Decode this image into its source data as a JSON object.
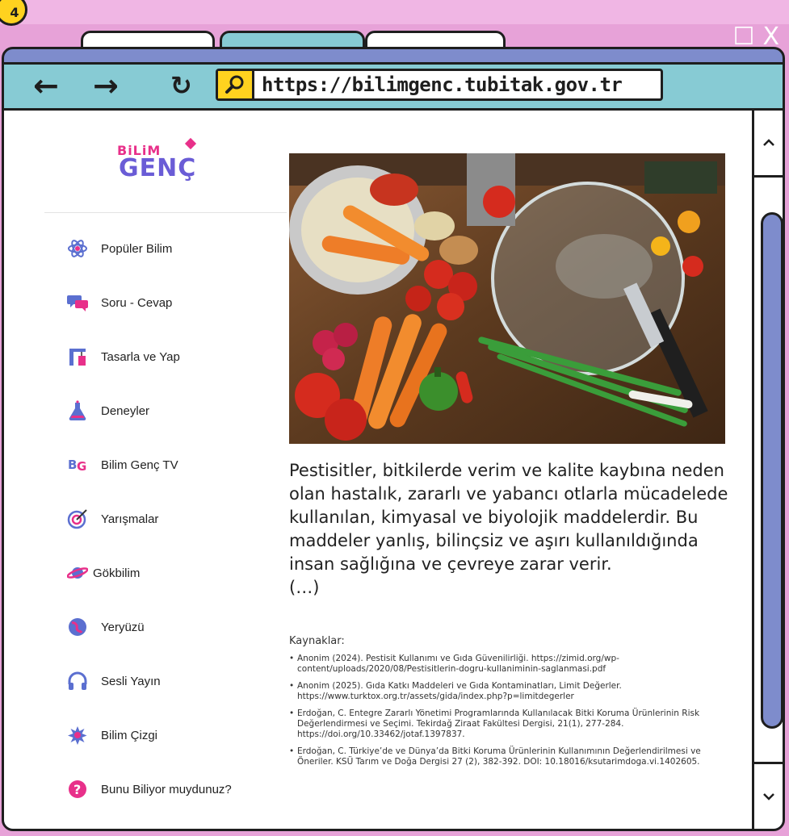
{
  "page_number": "4",
  "window_controls": {
    "minimize": "_",
    "maximize": "☐",
    "close": "X"
  },
  "toolbar": {
    "back": "←",
    "forward": "→",
    "reload": "↻",
    "url": "https://bilimgenc.tubitak.gov.tr"
  },
  "logo": {
    "line1": "BiLiM",
    "line2": "GENÇ"
  },
  "nav": [
    {
      "label": "Popüler Bilim",
      "icon": "atom-icon"
    },
    {
      "label": "Soru - Cevap",
      "icon": "chat-bubbles-icon"
    },
    {
      "label": "Tasarla ve Yap",
      "icon": "crane-icon"
    },
    {
      "label": "Deneyler",
      "icon": "flask-icon"
    },
    {
      "label": "Bilim Genç TV",
      "icon": "bg-tv-icon"
    },
    {
      "label": "Yarışmalar",
      "icon": "target-icon"
    },
    {
      "label": "Gökbilim",
      "icon": "planet-icon"
    },
    {
      "label": "Yeryüzü",
      "icon": "globe-icon"
    },
    {
      "label": "Sesli Yayın",
      "icon": "headphones-icon"
    },
    {
      "label": "Bilim Çizgi",
      "icon": "splash-icon"
    },
    {
      "label": "Bunu Biliyor muydunuz?",
      "icon": "question-icon"
    }
  ],
  "article": {
    "body": "Pestisitler, bitkilerde verim ve kalite kaybına neden olan hastalık, zararlı ve yabancı otlarla mücadelede kullanılan, kimyasal ve biyolojik maddelerdir. Bu maddeler yanlış, bilinçsiz ve aşırı kullanıldığında insan sağlığına ve çevreye zarar verir.",
    "ellipsis": "(…)",
    "refs_title": "Kaynaklar:",
    "refs": [
      "Anonim (2024). Pestisit Kullanımı ve Gıda Güvenilirliği. https://zimid.org/wp-content/uploads/2020/08/Pestisitlerin-dogru-kullaniminin-saglanmasi.pdf",
      "Anonim (2025). Gıda Katkı Maddeleri ve Gıda Kontaminatları, Limit Değerler. https://www.turktox.org.tr/assets/gida/index.php?p=limitdegerler",
      "Erdoğan, C. Entegre Zararlı Yönetimi Programlarında Kullanılacak Bitki Koruma Ürünlerinin Risk Değerlendirmesi ve Seçimi. Tekirdağ Ziraat Fakültesi Dergisi, 21(1), 277-284. https://doi.org/10.33462/jotaf.1397837.",
      "Erdoğan, C. Türkiye’de ve Dünya’da Bitki Koruma Ürünlerinin Kullanımının Değerlendirilmesi ve Öneriler. KSÜ Tarım ve Doğa Dergisi 27 (2), 382-392. DOI: 10.18016/ksutarimdoga.vi.1402605."
    ]
  },
  "scrollbar": {
    "up": "^",
    "down": "v"
  }
}
